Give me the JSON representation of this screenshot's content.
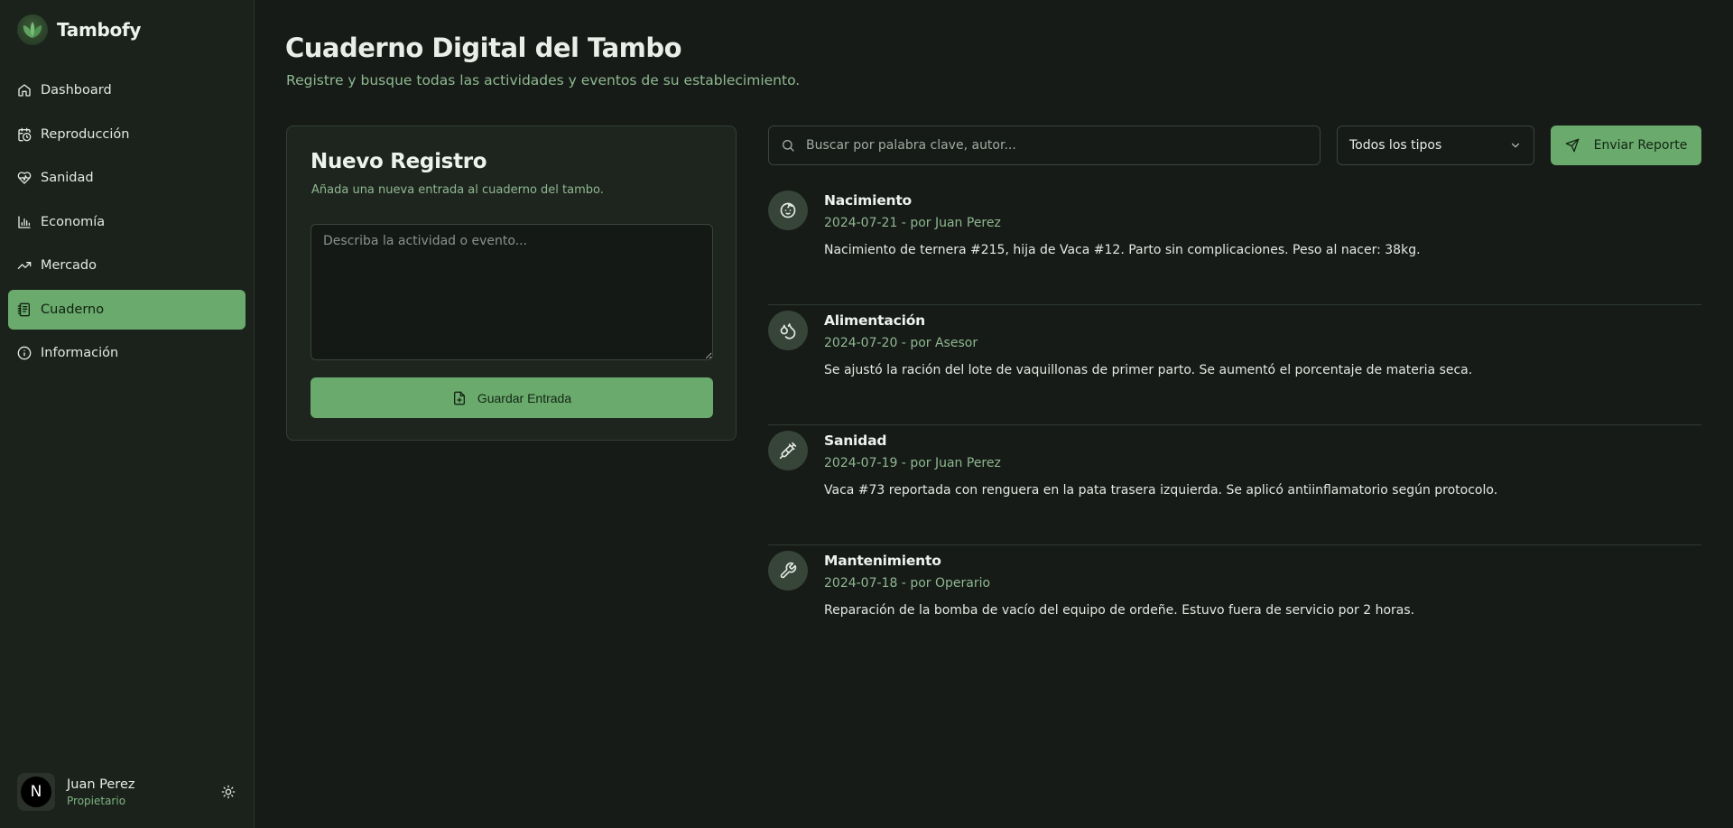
{
  "app": {
    "name": "Tambofy",
    "logo_icon": "leaf-logo-icon"
  },
  "sidebar": {
    "items": [
      {
        "label": "Dashboard",
        "icon": "home-icon",
        "active": false
      },
      {
        "label": "Reproducción",
        "icon": "calendar-clock-icon",
        "active": false
      },
      {
        "label": "Sanidad",
        "icon": "heart-pulse-icon",
        "active": false
      },
      {
        "label": "Economía",
        "icon": "bar-chart-icon",
        "active": false
      },
      {
        "label": "Mercado",
        "icon": "trending-up-icon",
        "active": false
      },
      {
        "label": "Cuaderno",
        "icon": "notebook-icon",
        "active": true
      },
      {
        "label": "Información",
        "icon": "info-icon",
        "active": false
      }
    ],
    "user": {
      "initial": "N",
      "name": "Juan Perez",
      "role": "Propietario",
      "theme_icon": "sun-icon"
    }
  },
  "header": {
    "title": "Cuaderno Digital del Tambo",
    "subtitle": "Registre y busque todas las actividades y eventos de su establecimiento."
  },
  "new_entry": {
    "title": "Nuevo Registro",
    "subtitle": "Añada una nueva entrada al cuaderno del tambo.",
    "textarea_placeholder": "Describa la actividad o evento...",
    "textarea_value": "",
    "save_label": "Guardar Entrada",
    "save_icon": "file-plus-icon"
  },
  "toolbar": {
    "search_placeholder": "Buscar por palabra clave, autor...",
    "search_value": "",
    "search_icon": "search-icon",
    "filter_selected": "Todos los tipos",
    "report_label": "Enviar Reporte",
    "report_icon": "send-icon"
  },
  "entries": [
    {
      "title": "Nacimiento",
      "meta": "2024-07-21 - por Juan Perez",
      "text": "Nacimiento de ternera #215, hija de Vaca #12. Parto sin complicaciones. Peso al nacer: 38kg.",
      "icon": "baby-icon"
    },
    {
      "title": "Alimentación",
      "meta": "2024-07-20 - por Asesor",
      "text": "Se ajustó la ración del lote de vaquillonas de primer parto. Se aumentó el porcentaje de materia seca.",
      "icon": "droplets-icon"
    },
    {
      "title": "Sanidad",
      "meta": "2024-07-19 - por Juan Perez",
      "text": "Vaca #73 reportada con renguera en la pata trasera izquierda. Se aplicó antiinflamatorio según protocolo.",
      "icon": "syringe-icon"
    },
    {
      "title": "Mantenimiento",
      "meta": "2024-07-18 - por Operario",
      "text": "Reparación de la bomba de vacío del equipo de ordeñe. Estuvo fuera de servicio por 2 horas.",
      "icon": "wrench-icon"
    }
  ],
  "colors": {
    "background": "#161b17",
    "sidebar": "#1b221c",
    "accent": "#6aaa6d",
    "muted_green": "#8fb890"
  }
}
